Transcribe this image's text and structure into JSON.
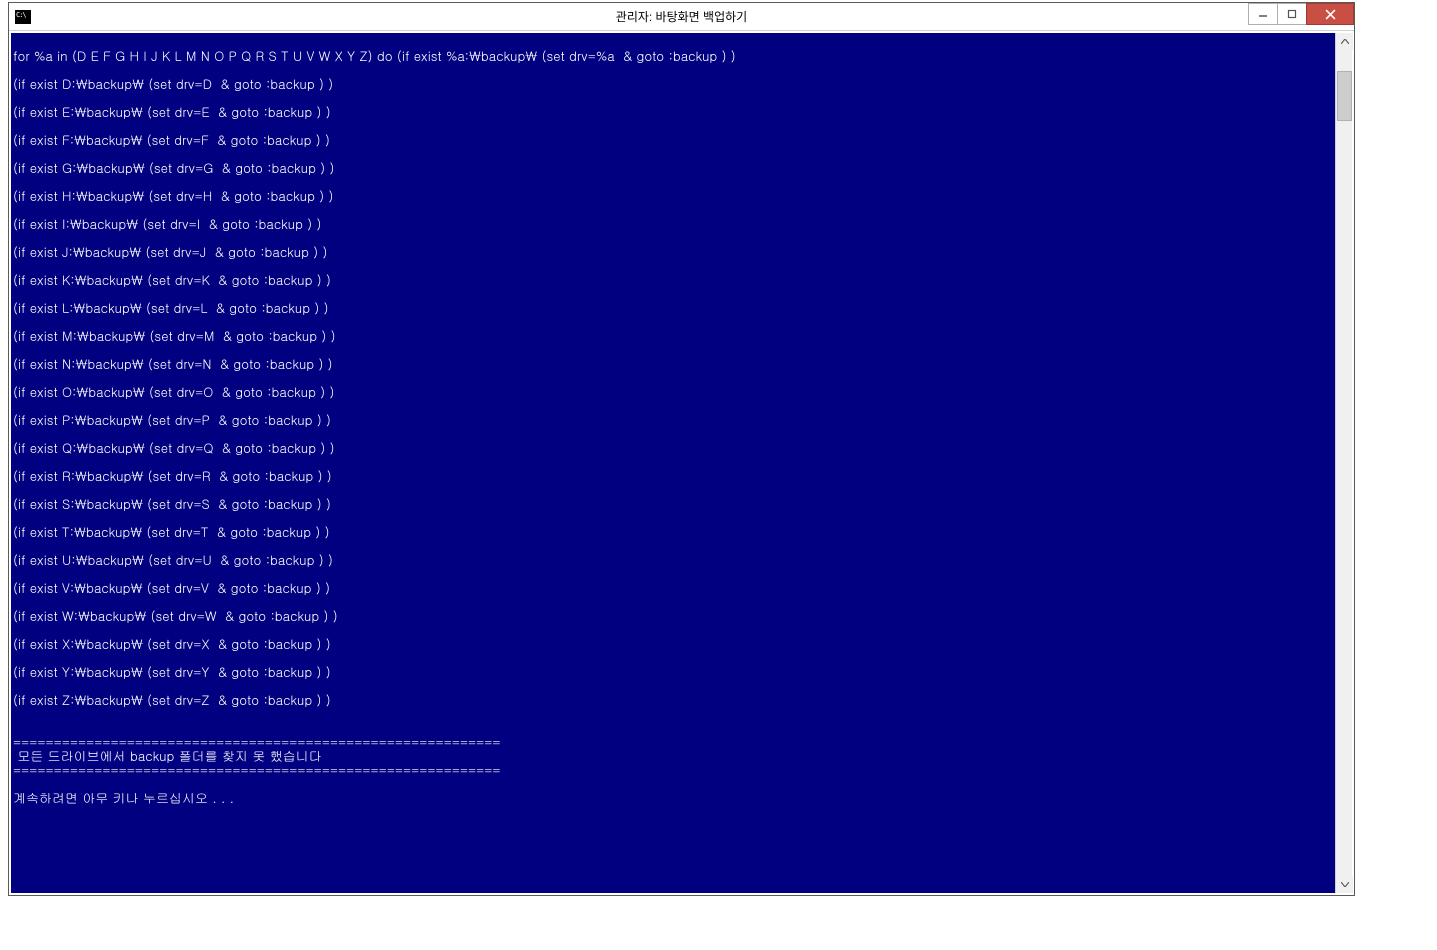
{
  "window": {
    "title": "관리자: 바탕화면 백업하기"
  },
  "console": {
    "lines": [
      "",
      "for %a in (D E F G H I J K L M N O P Q R S T U V W X Y Z) do (if exist %a:\\backup\\ (set drv=%a  & goto :backup ) )",
      "",
      "(if exist D:\\backup\\ (set drv=D  & goto :backup ) )",
      "",
      "(if exist E:\\backup\\ (set drv=E  & goto :backup ) )",
      "",
      "(if exist F:\\backup\\ (set drv=F  & goto :backup ) )",
      "",
      "(if exist G:\\backup\\ (set drv=G  & goto :backup ) )",
      "",
      "(if exist H:\\backup\\ (set drv=H  & goto :backup ) )",
      "",
      "(if exist I:\\backup\\ (set drv=I  & goto :backup ) )",
      "",
      "(if exist J:\\backup\\ (set drv=J  & goto :backup ) )",
      "",
      "(if exist K:\\backup\\ (set drv=K  & goto :backup ) )",
      "",
      "(if exist L:\\backup\\ (set drv=L  & goto :backup ) )",
      "",
      "(if exist M:\\backup\\ (set drv=M  & goto :backup ) )",
      "",
      "(if exist N:\\backup\\ (set drv=N  & goto :backup ) )",
      "",
      "(if exist O:\\backup\\ (set drv=O  & goto :backup ) )",
      "",
      "(if exist P:\\backup\\ (set drv=P  & goto :backup ) )",
      "",
      "(if exist Q:\\backup\\ (set drv=Q  & goto :backup ) )",
      "",
      "(if exist R:\\backup\\ (set drv=R  & goto :backup ) )",
      "",
      "(if exist S:\\backup\\ (set drv=S  & goto :backup ) )",
      "",
      "(if exist T:\\backup\\ (set drv=T  & goto :backup ) )",
      "",
      "(if exist U:\\backup\\ (set drv=U  & goto :backup ) )",
      "",
      "(if exist V:\\backup\\ (set drv=V  & goto :backup ) )",
      "",
      "(if exist W:\\backup\\ (set drv=W  & goto :backup ) )",
      "",
      "(if exist X:\\backup\\ (set drv=X  & goto :backup ) )",
      "",
      "(if exist Y:\\backup\\ (set drv=Y  & goto :backup ) )",
      "",
      "(if exist Z:\\backup\\ (set drv=Z  & goto :backup ) )",
      "",
      "",
      "============================================================",
      " 모든 드라이브에서 backup 폴더를 찾지 못 했습니다",
      "============================================================",
      "",
      "계속하려면 아무 키나 누르십시오 . . ."
    ]
  }
}
